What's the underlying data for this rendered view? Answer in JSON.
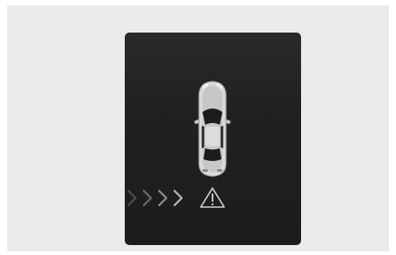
{
  "display": {
    "icons": [
      "car-top-view-icon",
      "chevron-right-icon",
      "warning-triangle-icon"
    ],
    "chevron_count": 4,
    "chevron_colors": [
      "#4e4e4e",
      "#6a6a6a",
      "#8c8c8c",
      "#b4b4b4"
    ],
    "warning_color": "#d0d0d0",
    "car_body_color": "#d9d9d9",
    "car_glass_color": "#1c1c1c",
    "background_color": "#ebebeb",
    "screen_color": "#222222"
  }
}
